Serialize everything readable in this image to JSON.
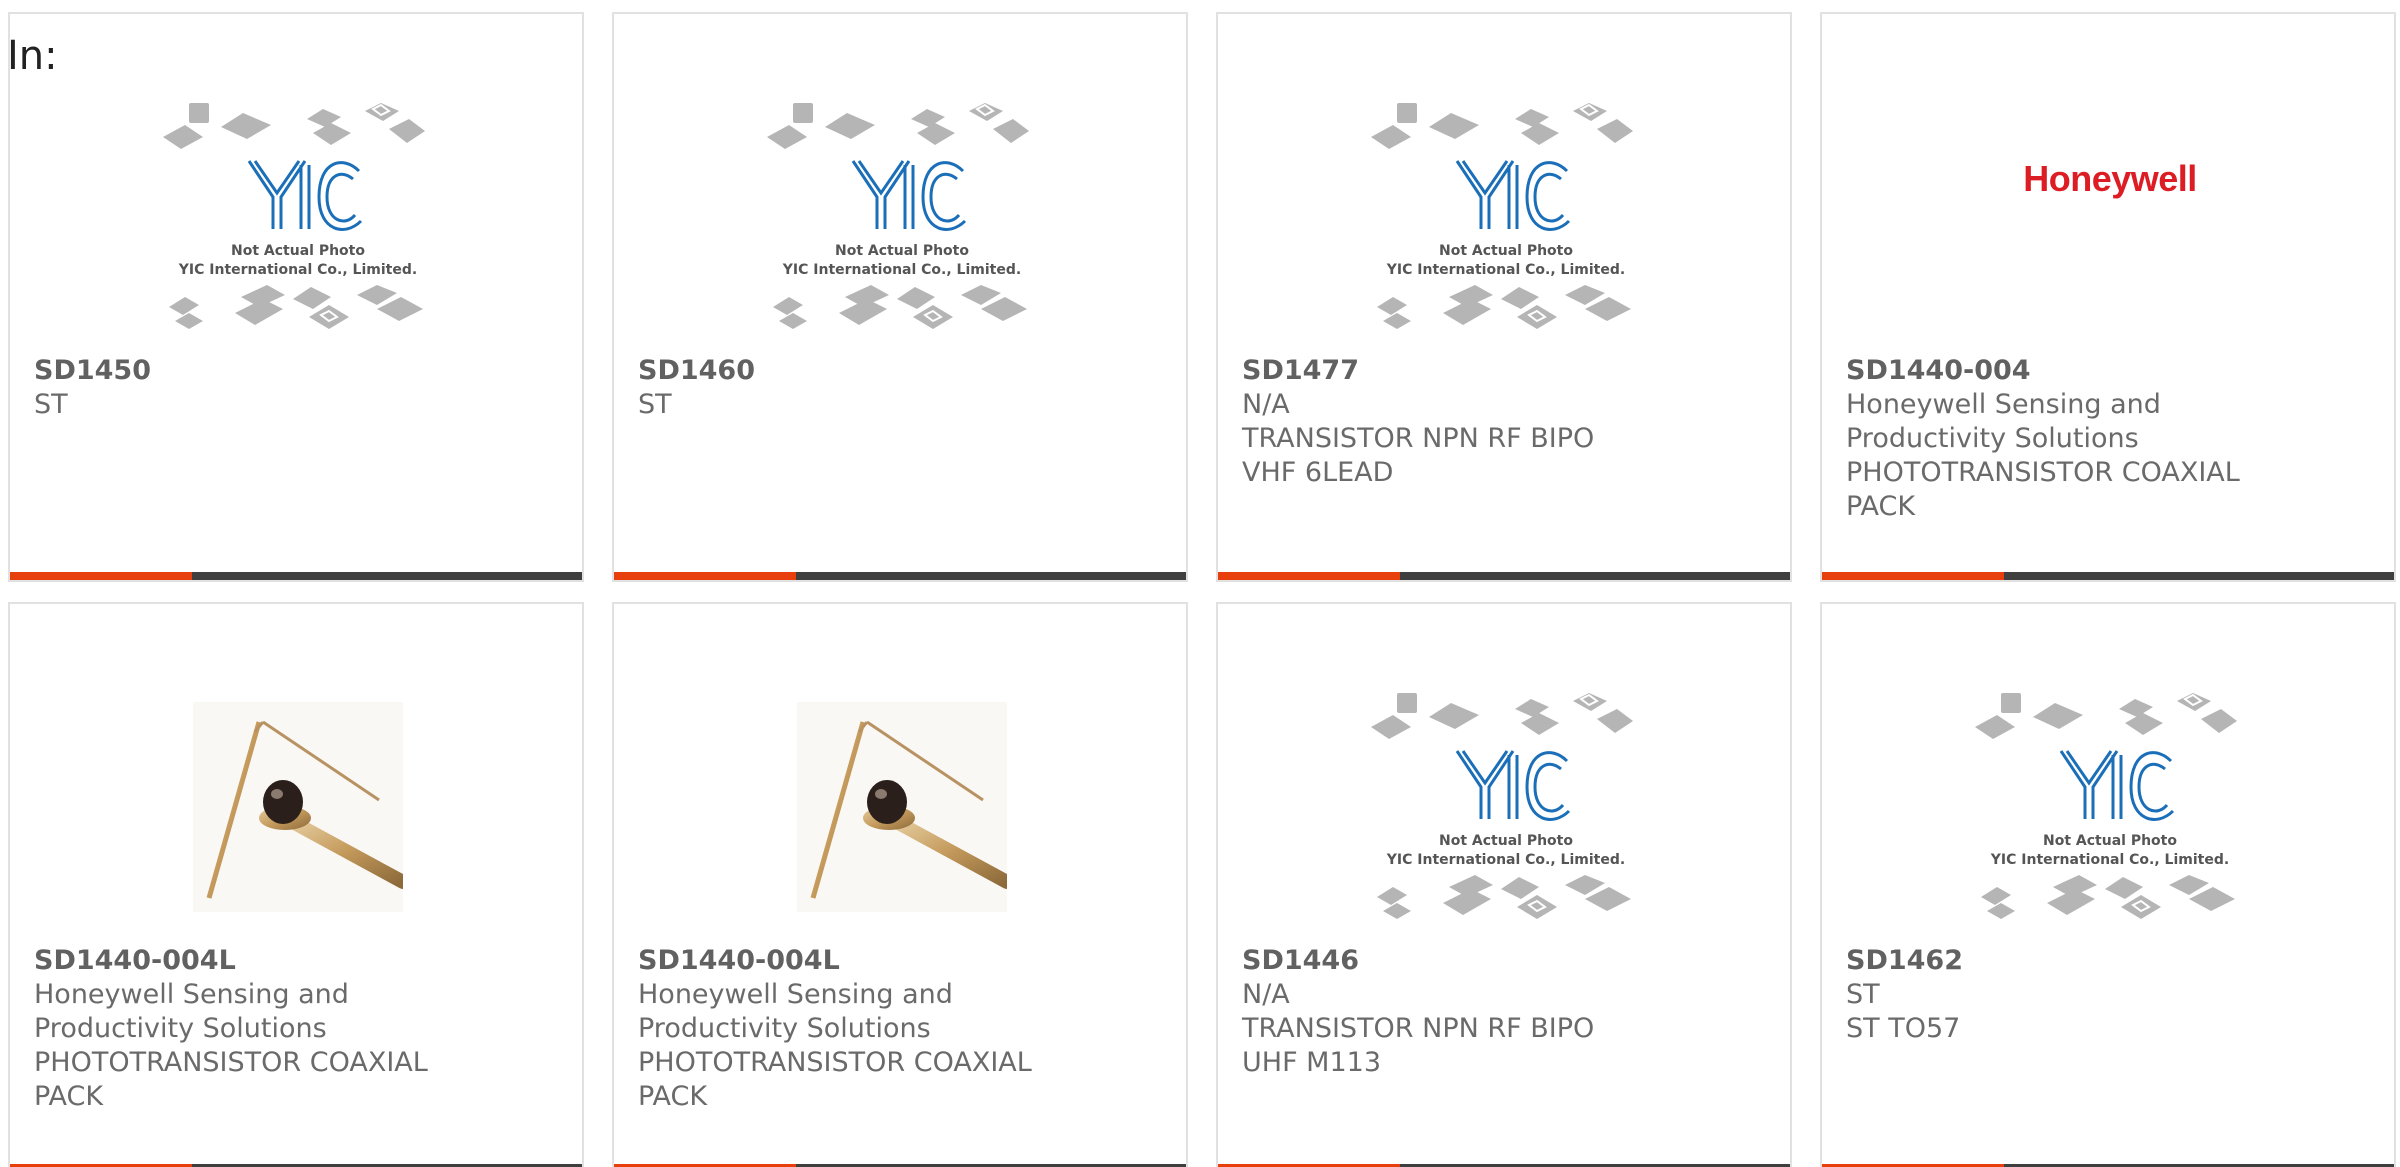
{
  "page": {
    "in_label": "In:"
  },
  "placeholder_text": {
    "line1": "Not Actual Photo",
    "line2": "YIC International Co., Limited."
  },
  "brand_logo_text": "Honeywell",
  "colors": {
    "accent": "#e8400c",
    "bar_dark": "#3f3f3f",
    "card_border": "#e1e1e1",
    "text": "#6a6a6a",
    "honeywell_red": "#dc1e24",
    "yic_blue": "#1b6fb8"
  },
  "products": [
    {
      "part": "SD1450",
      "manufacturer": "ST",
      "description": "",
      "image": "yic-placeholder"
    },
    {
      "part": "SD1460",
      "manufacturer": "ST",
      "description": "",
      "image": "yic-placeholder"
    },
    {
      "part": "SD1477",
      "manufacturer": "N/A",
      "description": "TRANSISTOR NPN RF BIPO VHF 6LEAD",
      "image": "yic-placeholder"
    },
    {
      "part": "SD1440-004",
      "manufacturer": "Honeywell Sensing and Productivity Solutions",
      "description": "PHOTOTRANSISTOR COAXIAL PACK",
      "image": "honeywell-logo"
    },
    {
      "part": "SD1440-004L",
      "manufacturer": "Honeywell Sensing and Productivity Solutions",
      "description": "PHOTOTRANSISTOR COAXIAL PACK",
      "image": "phototransistor-photo"
    },
    {
      "part": "SD1440-004L",
      "manufacturer": "Honeywell Sensing and Productivity Solutions",
      "description": "PHOTOTRANSISTOR COAXIAL PACK",
      "image": "phototransistor-photo"
    },
    {
      "part": "SD1446",
      "manufacturer": "N/A",
      "description": "TRANSISTOR NPN RF BIPO UHF M113",
      "image": "yic-placeholder"
    },
    {
      "part": "SD1462",
      "manufacturer": "ST",
      "description": "ST TO57",
      "image": "yic-placeholder"
    }
  ]
}
